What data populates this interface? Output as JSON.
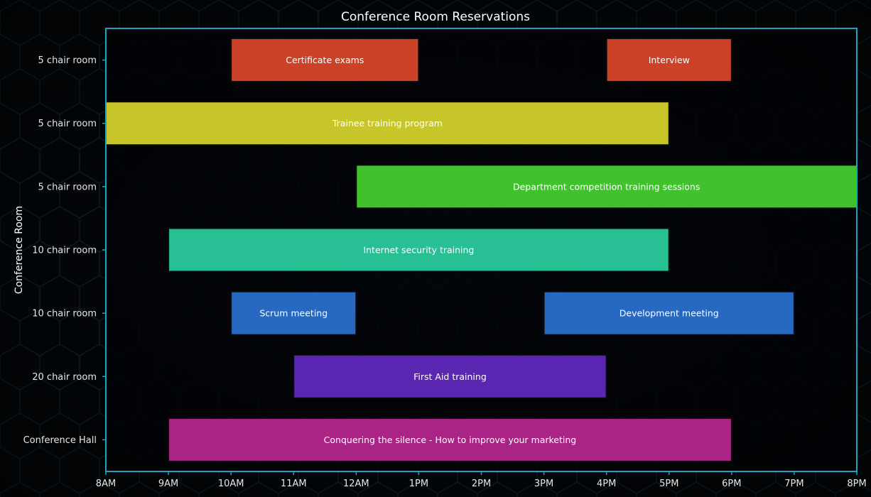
{
  "chart_data": {
    "type": "gantt",
    "title": "Conference Room Reservations",
    "ylabel": "Conference Room",
    "xlabel": "",
    "x_ticks": [
      "8AM",
      "9AM",
      "10AM",
      "11AM",
      "12AM",
      "1PM",
      "2PM",
      "3PM",
      "4PM",
      "5PM",
      "6PM",
      "7PM",
      "8PM"
    ],
    "xlim": [
      8,
      20
    ],
    "rows": [
      "5 chair room",
      "5 chair room",
      "5 chair room",
      "10 chair room",
      "10 chair room",
      "20 chair room",
      "Conference Hall"
    ],
    "tasks": [
      {
        "label": "Certificate exams",
        "row": 0,
        "start": 10,
        "end": 13,
        "color": "#cc4228"
      },
      {
        "label": "Interview",
        "row": 0,
        "start": 16,
        "end": 18,
        "color": "#cc4228"
      },
      {
        "label": "Trainee training program",
        "row": 1,
        "start": 8,
        "end": 17,
        "color": "#c8c52a"
      },
      {
        "label": "Department competition training sessions",
        "row": 2,
        "start": 12,
        "end": 20,
        "color": "#3fc22c"
      },
      {
        "label": "Internet security training",
        "row": 3,
        "start": 9,
        "end": 17,
        "color": "#27bf93"
      },
      {
        "label": "Scrum meeting",
        "row": 4,
        "start": 10,
        "end": 12,
        "color": "#2768c1"
      },
      {
        "label": "Development meeting",
        "row": 4,
        "start": 15,
        "end": 19,
        "color": "#2768c1"
      },
      {
        "label": "First Aid training",
        "row": 5,
        "start": 11,
        "end": 16,
        "color": "#5b26b1"
      },
      {
        "label": "Conquering the silence - How to improve your marketing",
        "row": 6,
        "start": 9,
        "end": 18,
        "color": "#aa2485"
      }
    ],
    "colors": {
      "background": "#04080c",
      "axis": "#1fa4c0",
      "text": "#e6e6e6",
      "bar_border": "#0a0a0a"
    }
  }
}
